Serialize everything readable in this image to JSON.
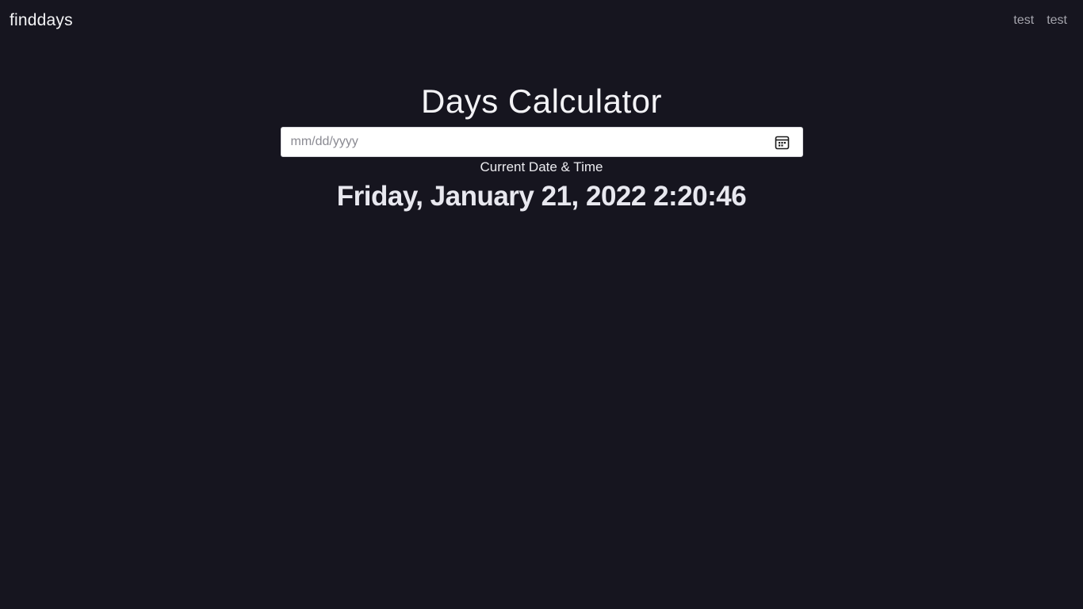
{
  "navbar": {
    "brand": "finddays",
    "links": [
      {
        "label": "test"
      },
      {
        "label": "test"
      }
    ]
  },
  "main": {
    "title": "Days Calculator",
    "date_input": {
      "placeholder": "mm/dd/yyyy",
      "value": "",
      "icon": "calendar-icon"
    },
    "current_label": "Current Date & Time",
    "current_datetime": "Friday, January 21, 2022 2:20:46"
  },
  "colors": {
    "background": "#16151f",
    "text": "#f1f1f4",
    "nav_link": "#a4a4ac",
    "input_bg": "#ffffff"
  }
}
